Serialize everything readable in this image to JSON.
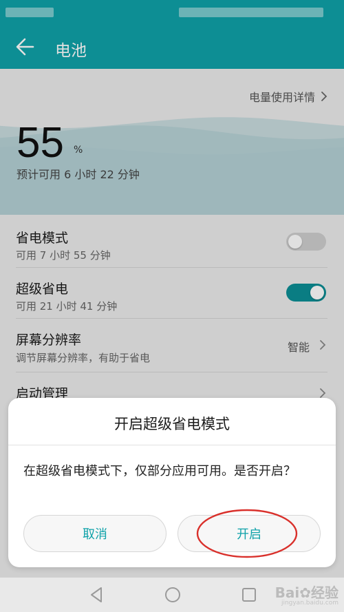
{
  "app": {
    "title": "电池"
  },
  "battery": {
    "usage_link": "电量使用详情",
    "percent": "55",
    "percent_sign": "%",
    "estimate": "预计可用 6 小时 22 分钟",
    "level": 0.55
  },
  "settings": [
    {
      "title": "省电模式",
      "subtitle": "可用 7 小时 55 分钟",
      "toggle": "off"
    },
    {
      "title": "超级省电",
      "subtitle": "可用 21 小时 41 分钟",
      "toggle": "on"
    },
    {
      "title": "屏幕分辨率",
      "subtitle": "调节屏幕分辨率，有助于省电",
      "value": "智能"
    },
    {
      "title": "启动管理"
    }
  ],
  "dialog": {
    "title": "开启超级省电模式",
    "message": "在超级省电模式下，仅部分应用可用。是否开启？",
    "cancel_label": "取消",
    "confirm_label": "开启"
  },
  "icons": {
    "back": "arrow-left-icon",
    "chevron": "chevron-right-icon",
    "nav_back": "triangle-back-icon",
    "nav_home": "circle-home-icon",
    "nav_recent": "square-recent-icon"
  },
  "colors": {
    "accent": "#0fa2a9",
    "toggle_on": "#0c8f96",
    "highlight_ring": "#d9302b"
  },
  "watermark": {
    "brand": "Bai",
    "suffix": "经验",
    "url": "jingyan.baidu.com"
  }
}
